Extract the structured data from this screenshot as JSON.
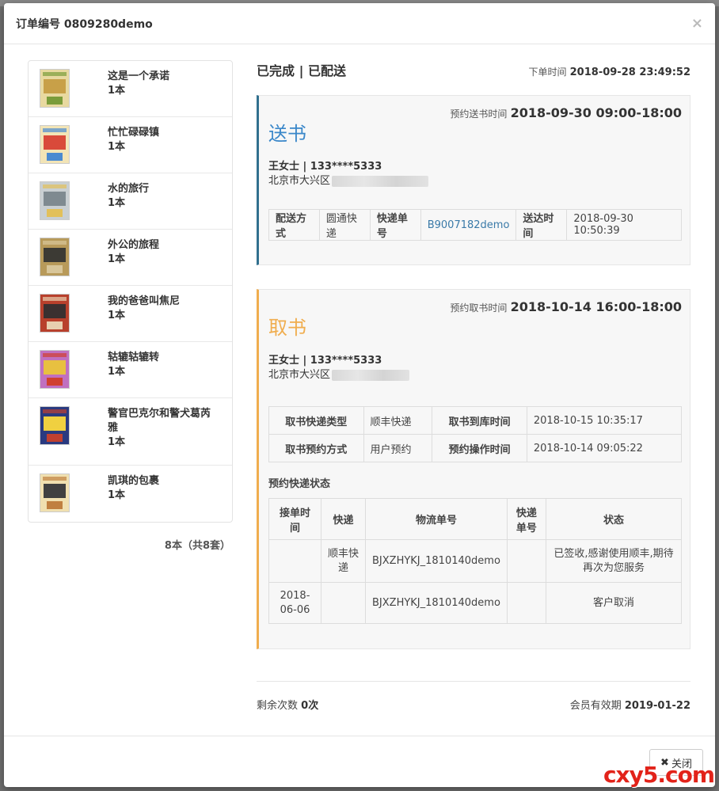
{
  "modal": {
    "title": "订单编号 0809280demo",
    "close_icon": "×"
  },
  "books": [
    {
      "name": "这是一个承诺",
      "qty": "1本",
      "cover": [
        "#e8d9a0",
        "#c8a048",
        "#7a9c3a"
      ]
    },
    {
      "name": "忙忙碌碌镇",
      "qty": "1本",
      "cover": [
        "#f2e4b6",
        "#d94a3a",
        "#4a8ad0"
      ]
    },
    {
      "name": "水的旅行",
      "qty": "1本",
      "cover": [
        "#c9cfd2",
        "#7f8a90",
        "#e2c05a"
      ]
    },
    {
      "name": "外公的旅程",
      "qty": "1本",
      "cover": [
        "#b89a5a",
        "#3c3a34",
        "#d8c69a"
      ]
    },
    {
      "name": "我的爸爸叫焦尼",
      "qty": "1本",
      "cover": [
        "#b8402c",
        "#3a3030",
        "#e8d0b0"
      ]
    },
    {
      "name": "轱辘轱辘转",
      "qty": "1本",
      "cover": [
        "#c070c0",
        "#e8c040",
        "#d04030"
      ]
    },
    {
      "name": "警官巴克尔和警犬葛芮雅",
      "qty": "1本",
      "cover": [
        "#2a3a80",
        "#f0d040",
        "#c04030"
      ]
    },
    {
      "name": "凯琪的包裹",
      "qty": "1本",
      "cover": [
        "#f0e0b0",
        "#404040",
        "#c08040"
      ]
    }
  ],
  "book_total": "8本（共8套）",
  "status": "已完成 | 已配送",
  "order_time": {
    "label": "下单时间",
    "value": "2018-09-28 23:49:52"
  },
  "deliver": {
    "heading": "送书",
    "appt_label": "预约送书时间",
    "appt_value": "2018-09-30 09:00-18:00",
    "contact": "王女士 | 133****5333",
    "address": "北京市大兴区",
    "table": {
      "method_label": "配送方式",
      "method_value": "圆通快递",
      "tracking_label": "快递单号",
      "tracking_value": "B9007182demo",
      "arrive_label": "送达时间",
      "arrive_value": "2018-09-30 10:50:39"
    }
  },
  "pickup": {
    "heading": "取书",
    "appt_label": "预约取书时间",
    "appt_value": "2018-10-14 16:00-18:00",
    "contact": "王女士 | 133****5333",
    "address": "北京市大兴区",
    "table": {
      "type_label": "取书快递类型",
      "type_value": "顺丰快递",
      "stock_label": "取书到库时间",
      "stock_value": "2018-10-15 10:35:17",
      "way_label": "取书预约方式",
      "way_value": "用户预约",
      "op_label": "预约操作时间",
      "op_value": "2018-10-14 09:05:22"
    },
    "express_title": "预约快递状态",
    "express_headers": [
      "接单时间",
      "快递",
      "物流单号",
      "快递单号",
      "状态"
    ],
    "express_rows": [
      {
        "time": "",
        "courier": "顺丰快递",
        "logistics": "BJXZHYKJ_1810140demo",
        "tracking": "",
        "status": "已签收,感谢使用顺丰,期待再次为您服务"
      },
      {
        "time": "2018-06-06",
        "courier": "",
        "logistics": "BJXZHYKJ_1810140demo",
        "tracking": "",
        "status": "客户取消"
      }
    ]
  },
  "footer_info": {
    "remaining_label": "剩余次数",
    "remaining_value": "0次",
    "expiry_label": "会员有效期",
    "expiry_value": "2019-01-22"
  },
  "close_button": {
    "icon": "✖",
    "label": "关闭"
  },
  "watermark": "cxy5.com"
}
